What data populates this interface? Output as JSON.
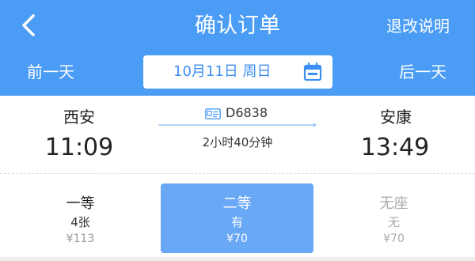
{
  "header": {
    "title": "确认订单",
    "right_action": "退改说明",
    "back_icon": "chevron-left-icon",
    "prev_day": "前一天",
    "next_day": "后一天",
    "date": "10月11日 周日",
    "calendar_icon": "calendar-icon"
  },
  "trip": {
    "from_station": "西安",
    "to_station": "安康",
    "depart_time": "11:09",
    "arrive_time": "13:49",
    "train_number": "D6838",
    "train_icon": "id-card-icon",
    "duration": "2小时40分钟"
  },
  "seats": [
    {
      "name": "一等",
      "availability": "4张",
      "price": "¥113",
      "selected": false
    },
    {
      "name": "二等",
      "availability": "有",
      "price": "¥70",
      "selected": true
    },
    {
      "name": "无座",
      "availability": "无",
      "price": "¥70",
      "selected": false
    }
  ],
  "colors": {
    "brand": "#4a9cf5",
    "selected_seat": "#68a8f4",
    "date_text": "#3d8ef2"
  }
}
